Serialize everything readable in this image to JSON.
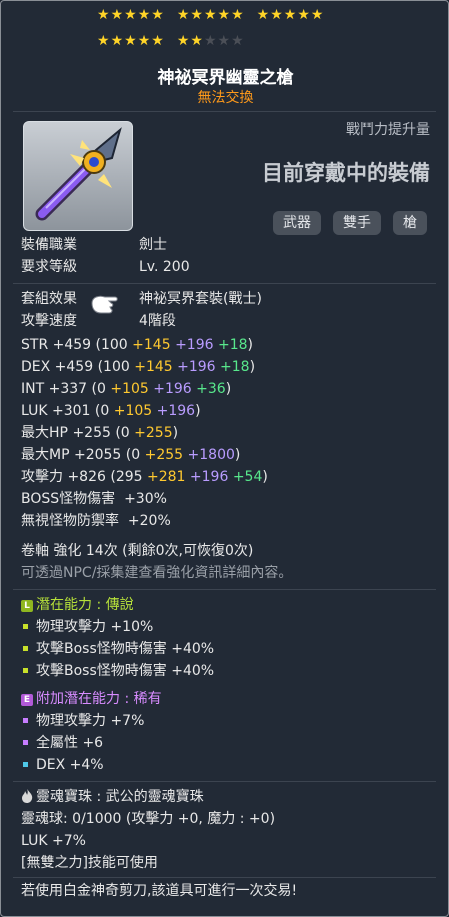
{
  "stars": {
    "filled": 22,
    "total": 25,
    "filled_glyph": "★",
    "empty_glyph": "★"
  },
  "item": {
    "name": "神祕冥界幽靈之槍",
    "trade_status": "無法交換"
  },
  "combat_power_label": "戰鬥力提升量",
  "equipped_label": "目前穿戴中的裝備",
  "tags": [
    "武器",
    "雙手",
    "槍"
  ],
  "requirements": {
    "job_label": "裝備職業",
    "job_value": "劍士",
    "level_label": "要求等級",
    "level_value": "Lv. 200"
  },
  "set_effect": {
    "label": "套組效果",
    "value": "神祕冥界套裝(戰士)"
  },
  "attack_speed": {
    "label": "攻擊速度",
    "value": "4階段"
  },
  "stats": [
    {
      "name": "STR",
      "total": "+459",
      "open": "(100",
      "parts": [
        {
          "v": "+145",
          "c": "y"
        },
        {
          "v": "+196",
          "c": "p"
        },
        {
          "v": "+18",
          "c": "g"
        }
      ],
      "close": ")"
    },
    {
      "name": "DEX",
      "total": "+459",
      "open": "(100",
      "parts": [
        {
          "v": "+145",
          "c": "y"
        },
        {
          "v": "+196",
          "c": "p"
        },
        {
          "v": "+18",
          "c": "g"
        }
      ],
      "close": ")"
    },
    {
      "name": "INT",
      "total": "+337",
      "open": "(0",
      "parts": [
        {
          "v": "+105",
          "c": "y"
        },
        {
          "v": "+196",
          "c": "p"
        },
        {
          "v": "+36",
          "c": "g"
        }
      ],
      "close": ")"
    },
    {
      "name": "LUK",
      "total": "+301",
      "open": "(0",
      "parts": [
        {
          "v": "+105",
          "c": "y"
        },
        {
          "v": "+196",
          "c": "p"
        }
      ],
      "close": ")"
    },
    {
      "name": "最大HP",
      "total": "+255",
      "open": "(0",
      "parts": [
        {
          "v": "+255",
          "c": "y"
        }
      ],
      "close": ")"
    },
    {
      "name": "最大MP",
      "total": "+2055",
      "open": "(0",
      "parts": [
        {
          "v": "+255",
          "c": "y"
        },
        {
          "v": "+1800",
          "c": "p"
        }
      ],
      "close": ")"
    },
    {
      "name": "攻擊力",
      "total": "+826",
      "open": "(295",
      "parts": [
        {
          "v": "+281",
          "c": "y"
        },
        {
          "v": "+196",
          "c": "p"
        },
        {
          "v": "+54",
          "c": "g"
        }
      ],
      "close": ")"
    }
  ],
  "boss_damage": {
    "label": "BOSS怪物傷害",
    "value": "+30%"
  },
  "ignore_def": {
    "label": "無視怪物防禦率",
    "value": "+20%"
  },
  "scroll_line": "卷軸 強化 14次 (剩餘0次,可恢復0次)",
  "npc_hint": "可透過NPC/採集建查看強化資訊詳細內容。",
  "potential": {
    "badge": "L",
    "label": "潛在能力 : 傳說",
    "color": "#b6e03a",
    "lines": [
      "物理攻擊力 +10%",
      "攻擊Boss怪物時傷害 +40%",
      "攻擊Boss怪物時傷害 +40%"
    ]
  },
  "bonus_potential": {
    "badge": "E",
    "label": "附加潛在能力 : 稀有",
    "color": "#d88cff",
    "lines": [
      "物理攻擊力 +7%",
      "全屬性 +6",
      "DEX +4%"
    ],
    "bullet_colors": [
      "#c77dff",
      "#c77dff",
      "#4fc8e8"
    ]
  },
  "soul": {
    "label": "靈魂寶珠 : 武公的靈魂寶珠",
    "charge": "靈魂球: 0/1000 (攻擊力 +0, 魔力 : +0)",
    "option": "LUK +7%",
    "skill": "[無雙之力]技能可使用"
  },
  "scissors_note": "若使用白金神奇剪刀,該道具可進行一次交易!"
}
